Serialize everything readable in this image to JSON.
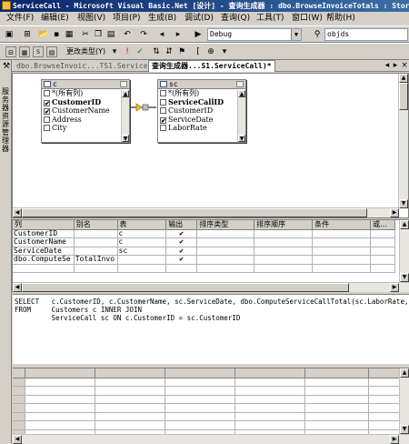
{
  "window": {
    "title": "ServiceCall - Microsoft Visual Basic.Net [设计] - 查询生成器 : dbo.BrowseInvoiceTotals : Store"
  },
  "menu": [
    "文件(F)",
    "编辑(E)",
    "视图(V)",
    "项目(P)",
    "生成(B)",
    "调试(D)",
    "查询(Q)",
    "工具(T)",
    "窗口(W)",
    "帮助(H)"
  ],
  "toolbar1": {
    "config": "Debug",
    "search": "objds"
  },
  "toolbar2": {
    "change_type": "更改类型(Y)"
  },
  "tabs": [
    {
      "label": "dbo.BrowseInvoic...TS1.ServiceCall)",
      "active": false
    },
    {
      "label": "查询生成器...S1.ServiceCall)*",
      "active": true
    }
  ],
  "server_explorer_label": "服务器资源管理器",
  "diagram": {
    "table1": {
      "name": "c",
      "columns": [
        {
          "label": "*(所有列)",
          "checked": false,
          "bold": false
        },
        {
          "label": "CustomerID",
          "checked": true,
          "bold": true
        },
        {
          "label": "CustomerName",
          "checked": true,
          "bold": false
        },
        {
          "label": "Address",
          "checked": false,
          "bold": false
        },
        {
          "label": "City",
          "checked": false,
          "bold": false
        }
      ]
    },
    "table2": {
      "name": "sc",
      "columns": [
        {
          "label": "*(所有列)",
          "checked": false,
          "bold": false
        },
        {
          "label": "ServiceCallID",
          "checked": false,
          "bold": true
        },
        {
          "label": "CustomerID",
          "checked": false,
          "bold": false
        },
        {
          "label": "ServiceDate",
          "checked": true,
          "bold": false
        },
        {
          "label": "LaborRate",
          "checked": false,
          "bold": false
        }
      ]
    }
  },
  "grid": {
    "headers": [
      "列",
      "别名",
      "表",
      "输出",
      "排序类型",
      "排序顺序",
      "条件",
      "或..."
    ],
    "rows": [
      {
        "column": "CustomerID",
        "alias": "",
        "table": "c",
        "output": "✔"
      },
      {
        "column": "CustomerName",
        "alias": "",
        "table": "c",
        "output": "✔"
      },
      {
        "column": "ServiceDate",
        "alias": "",
        "table": "sc",
        "output": "✔"
      },
      {
        "column": "dbo.ComputeSe",
        "alias": "TotalInvo",
        "table": "",
        "output": "✔"
      }
    ]
  },
  "sql": {
    "line1": "SELECT   c.CustomerID, c.CustomerName, sc.ServiceDate, dbo.ComputeServiceCallTotal(sc.LaborRate, sc.Hours, sc.P",
    "line2": "FROM     Customers c INNER JOIN",
    "line3": "         ServiceCall sc ON c.CustomerID = sc.CustomerID"
  }
}
